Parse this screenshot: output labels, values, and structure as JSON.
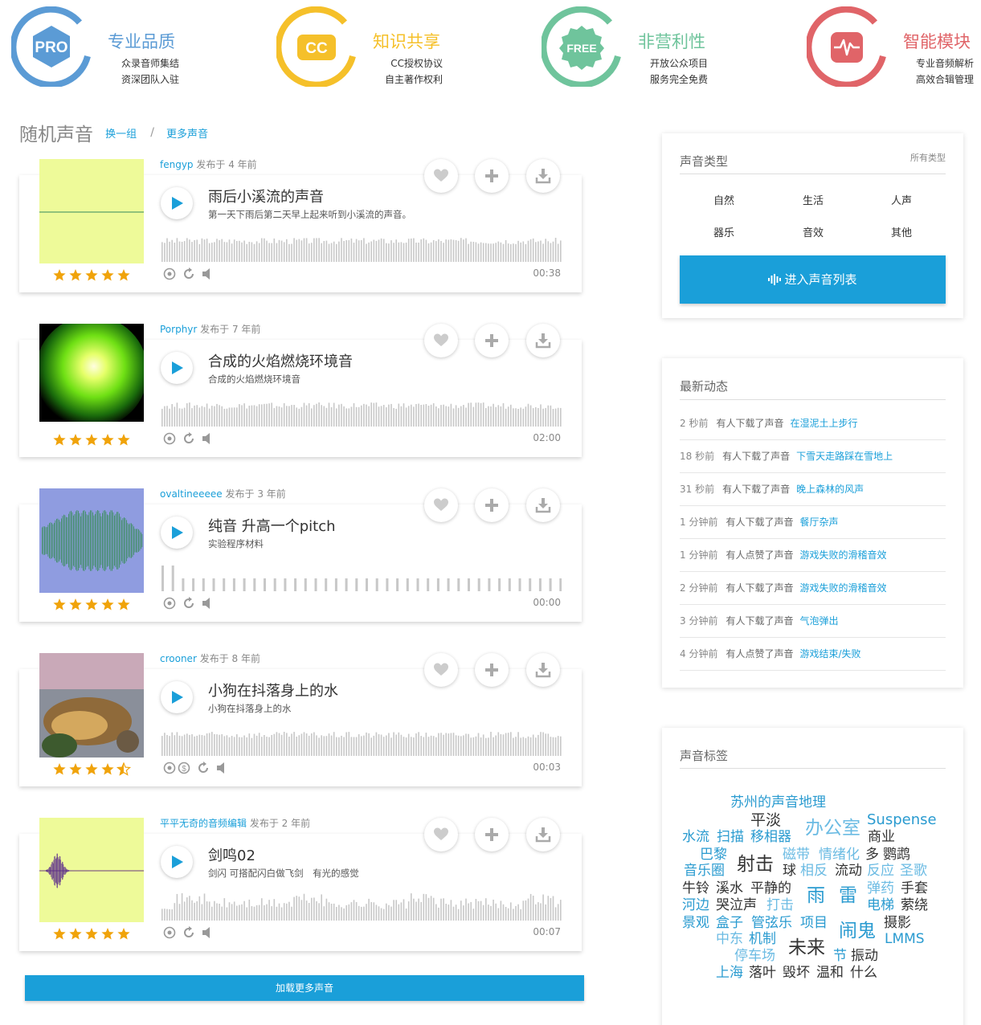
{
  "features": [
    {
      "badge": "PRO",
      "title": "专业品质",
      "line1": "众录音师集结",
      "line2": "资深团队入驻",
      "color": "#5b9bd5"
    },
    {
      "badge": "CC",
      "title": "知识共享",
      "line1": "CC授权协议",
      "line2": "自主著作权利",
      "color": "#f5c02a"
    },
    {
      "badge": "FREE",
      "title": "非营利性",
      "line1": "开放公众项目",
      "line2": "服务完全免费",
      "color": "#6fc49c"
    },
    {
      "badge": "",
      "title": "智能模块",
      "line1": "专业音频解析",
      "line2": "高效合辑管理",
      "color": "#e06468"
    }
  ],
  "random": {
    "title": "随机声音",
    "shuffle": "换一组",
    "sep": "/",
    "more": "更多声音"
  },
  "sounds": [
    {
      "user": "fengyp",
      "posted": "发布于 4 年前",
      "title": "雨后小溪流的声音",
      "desc": "第一天下雨后第二天早上起来听到小溪流的声音。",
      "duration": "00:38",
      "rating": 5
    },
    {
      "user": "Porphyr",
      "posted": "发布于 7 年前",
      "title": "合成的火焰燃烧环境音",
      "desc": "合成的火焰燃烧环境音",
      "duration": "02:00",
      "rating": 5
    },
    {
      "user": "ovaltineeeee",
      "posted": "发布于 3 年前",
      "title": "纯音 升高一个pitch",
      "desc": "实验程序材料",
      "duration": "00:00",
      "rating": 5
    },
    {
      "user": "crooner",
      "posted": "发布于 8 年前",
      "title": "小狗在抖落身上的水",
      "desc": "小狗在抖落身上的水",
      "duration": "00:03",
      "rating": 4.5
    },
    {
      "user": "平平无奇的音频编辑",
      "posted": "发布于 2 年前",
      "title": "剑鸣02",
      "desc": "剑闪 可搭配闪白做飞剑　有光的感觉",
      "duration": "00:07",
      "rating": 5
    }
  ],
  "load_more": "加载更多声音",
  "types": {
    "title": "声音类型",
    "all": "所有类型",
    "items": [
      "自然",
      "生活",
      "人声",
      "器乐",
      "音效",
      "其他"
    ],
    "enter": "进入声音列表"
  },
  "activity": {
    "title": "最新动态",
    "items": [
      {
        "time": "2 秒前",
        "verb": "有人下载了声音",
        "link": "在湿泥土上步行"
      },
      {
        "time": "18 秒前",
        "verb": "有人下载了声音",
        "link": "下雪天走路踩在雪地上"
      },
      {
        "time": "31 秒前",
        "verb": "有人下载了声音",
        "link": "晚上森林的风声"
      },
      {
        "time": "1 分钟前",
        "verb": "有人下载了声音",
        "link": "餐厅杂声"
      },
      {
        "time": "1 分钟前",
        "verb": "有人点赞了声音",
        "link": "游戏失败的滑稽音效"
      },
      {
        "time": "2 分钟前",
        "verb": "有人下载了声音",
        "link": "游戏失败的滑稽音效"
      },
      {
        "time": "3 分钟前",
        "verb": "有人下载了声音",
        "link": "气泡弹出"
      },
      {
        "time": "4 分钟前",
        "verb": "有人点赞了声音",
        "link": "游戏结束/失败"
      }
    ]
  },
  "tags": {
    "title": "声音标签",
    "items": [
      {
        "text": "苏州的声音地理",
        "color": "#2a9bd0"
      },
      {
        "text": "平淡",
        "color": "#333"
      },
      {
        "text": "办公室",
        "color": "#6bbbe3"
      },
      {
        "text": "Suspense",
        "color": "#2a9bd0"
      },
      {
        "text": "水流",
        "color": "#2a9bd0"
      },
      {
        "text": "扫描",
        "color": "#2a9bd0"
      },
      {
        "text": "移相器",
        "color": "#2a9bd0"
      },
      {
        "text": "商业",
        "color": "#333"
      },
      {
        "text": "巴黎",
        "color": "#2a9bd0"
      },
      {
        "text": "磁带",
        "color": "#6bbbe3"
      },
      {
        "text": "情绪化",
        "color": "#6bbbe3"
      },
      {
        "text": "多",
        "color": "#333"
      },
      {
        "text": "鹦鹉",
        "color": "#333"
      },
      {
        "text": "音乐圈",
        "color": "#2a9bd0"
      },
      {
        "text": "射击",
        "color": "#333"
      },
      {
        "text": "球",
        "color": "#333"
      },
      {
        "text": "相反",
        "color": "#6bbbe3"
      },
      {
        "text": "流动",
        "color": "#333"
      },
      {
        "text": "反应",
        "color": "#6bbbe3"
      },
      {
        "text": "圣歌",
        "color": "#6bbbe3"
      },
      {
        "text": "牛铃",
        "color": "#333"
      },
      {
        "text": "溪水",
        "color": "#333"
      },
      {
        "text": "平静的",
        "color": "#333"
      },
      {
        "text": "雨",
        "color": "#2a9bd0"
      },
      {
        "text": "雷",
        "color": "#2a9bd0"
      },
      {
        "text": "弹药",
        "color": "#6bbbe3"
      },
      {
        "text": "手套",
        "color": "#333"
      },
      {
        "text": "河边",
        "color": "#2a9bd0"
      },
      {
        "text": "哭泣声",
        "color": "#333"
      },
      {
        "text": "打击",
        "color": "#6bbbe3"
      },
      {
        "text": "电梯",
        "color": "#2a9bd0"
      },
      {
        "text": "萦绕",
        "color": "#333"
      },
      {
        "text": "景观",
        "color": "#2a9bd0"
      },
      {
        "text": "盒子",
        "color": "#2a9bd0"
      },
      {
        "text": "管弦乐",
        "color": "#2a9bd0"
      },
      {
        "text": "项目",
        "color": "#2a9bd0"
      },
      {
        "text": "闹鬼",
        "color": "#2a9bd0"
      },
      {
        "text": "摄影",
        "color": "#333"
      },
      {
        "text": "中东",
        "color": "#6bbbe3"
      },
      {
        "text": "机制",
        "color": "#2a9bd0"
      },
      {
        "text": "未来",
        "color": "#333"
      },
      {
        "text": "LMMS",
        "color": "#2a9bd0"
      },
      {
        "text": "停车场",
        "color": "#6bbbe3"
      },
      {
        "text": "节",
        "color": "#2a9bd0"
      },
      {
        "text": "振动",
        "color": "#333"
      },
      {
        "text": "上海",
        "color": "#2a9bd0"
      },
      {
        "text": "落叶",
        "color": "#333"
      },
      {
        "text": "毁坏",
        "color": "#333"
      },
      {
        "text": "温和",
        "color": "#333"
      },
      {
        "text": "什么",
        "color": "#333"
      }
    ]
  }
}
